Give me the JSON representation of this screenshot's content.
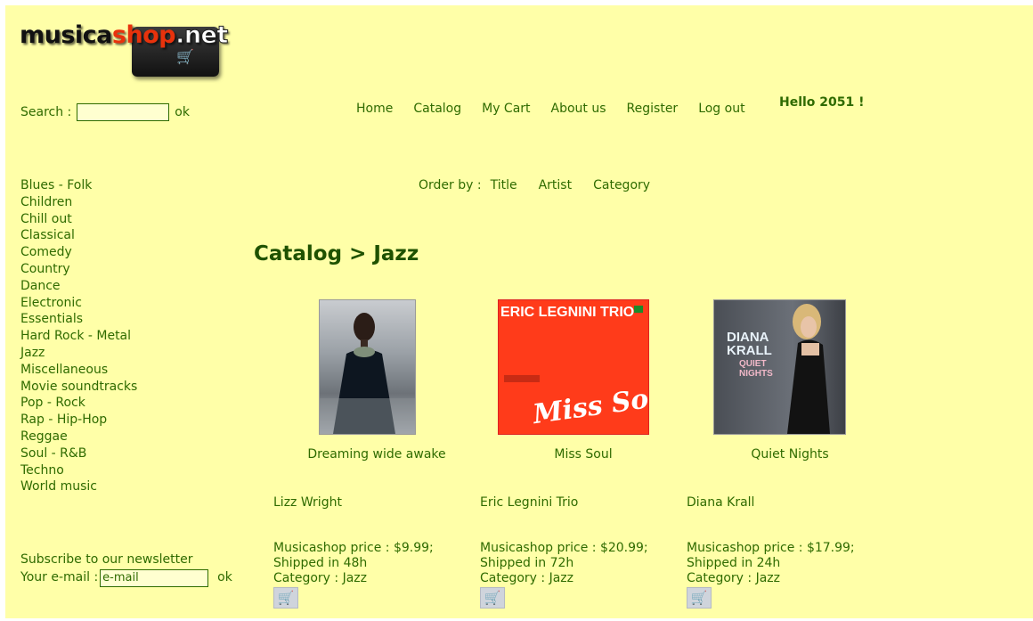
{
  "logo": {
    "part1": "musica",
    "part2": "shop",
    "part3": ".net"
  },
  "search": {
    "label": "Search :",
    "value": "",
    "button": "ok"
  },
  "nav": [
    "Home",
    "Catalog",
    "My Cart",
    "About us",
    "Register",
    "Log out"
  ],
  "greeting": "Hello 2051 !",
  "categories": [
    "Blues - Folk",
    "Children",
    "Chill out",
    "Classical",
    "Comedy",
    "Country",
    "Dance",
    "Electronic",
    "Essentials",
    "Hard Rock - Metal",
    "Jazz",
    "Miscellaneous",
    "Movie soundtracks",
    "Pop - Rock",
    "Rap - Hip-Hop",
    "Reggae",
    "Soul - R&B",
    "Techno",
    "World music"
  ],
  "orderby": {
    "label": "Order by :",
    "options": [
      "Title",
      "Artist",
      "Category"
    ]
  },
  "page_title": "Catalog > Jazz",
  "products": [
    {
      "title": "Dreaming wide awake",
      "artist": "Lizz Wright",
      "price": "Musicashop price : $9.99;",
      "shipping": "Shipped in 48h",
      "category": "Category : Jazz"
    },
    {
      "title": "Miss Soul",
      "artist": "Eric Legnini Trio",
      "price": "Musicashop price : $20.99;",
      "shipping": "Shipped in 72h",
      "category": "Category : Jazz",
      "cover_text_top": "ERIC LEGNINI TRIO",
      "cover_text_script": "Miss Soul"
    },
    {
      "title": "Quiet Nights",
      "artist": "Diana Krall",
      "price": "Musicashop price : $17.99;",
      "shipping": "Shipped in 24h",
      "category": "Category : Jazz",
      "cover_text_top": "DIANA KRALL",
      "cover_text_sub": "QUIET NIGHTS"
    }
  ],
  "newsletter": {
    "title": "Subscribe to our newsletter",
    "label": "Your e-mail :",
    "value": "e-mail",
    "button": "ok"
  },
  "colors": {
    "page_bg": "#ffffa8",
    "text": "#2f6b00",
    "title": "#1f5200"
  }
}
